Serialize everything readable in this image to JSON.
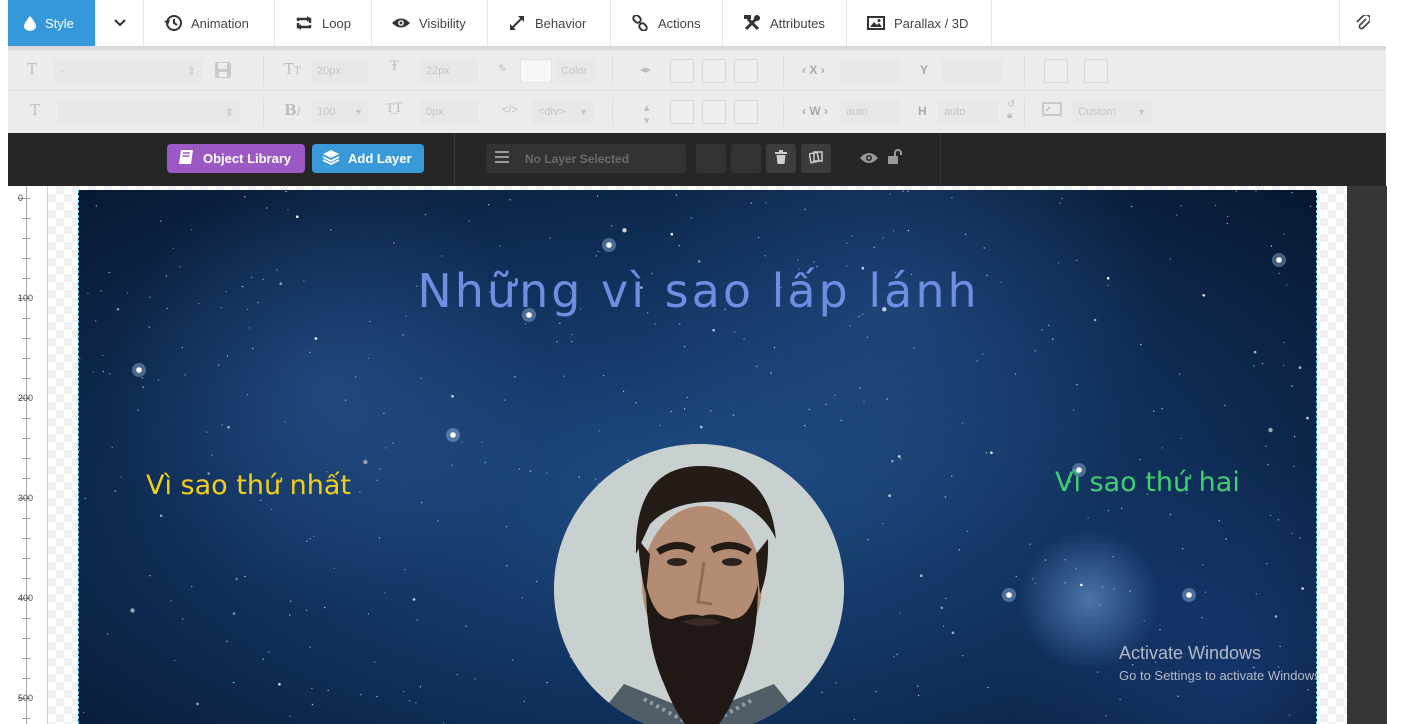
{
  "tabs": [
    {
      "label": "Style",
      "icon": "droplet-icon",
      "active": true
    },
    {
      "label": "Animation",
      "icon": "history-icon"
    },
    {
      "label": "Loop",
      "icon": "loop-icon"
    },
    {
      "label": "Visibility",
      "icon": "eye-icon"
    },
    {
      "label": "Behavior",
      "icon": "expand-arrows-icon"
    },
    {
      "label": "Actions",
      "icon": "link-icon"
    },
    {
      "label": "Attributes",
      "icon": "tools-icon"
    },
    {
      "label": "Parallax / 3D",
      "icon": "image-icon"
    }
  ],
  "style_panel": {
    "font_family_value": "-",
    "font_size": "20px",
    "line_height": "22px",
    "color_label": "Color",
    "font_weight": "100",
    "letter_spacing": "0px",
    "tag": "<div>",
    "x_label": "X",
    "y_label": "Y",
    "w_label": "W",
    "w_value": "auto",
    "h_label": "H",
    "h_value": "auto",
    "size_preset": "Custom"
  },
  "layer_toolbar": {
    "object_library_label": "Object Library",
    "add_layer_label": "Add Layer",
    "layer_select_value": "No Layer Selected"
  },
  "ruler": {
    "marks": [
      "0",
      "100",
      "200",
      "300",
      "400",
      "500"
    ]
  },
  "slide": {
    "title": "Những vì sao lấp lánh",
    "left_caption": "Vì sao thứ nhất",
    "right_caption": "Vì sao thứ hai"
  },
  "watermark": {
    "line1": "Activate Windows",
    "line2": "Go to Settings to activate Windows."
  },
  "colors": {
    "accent": "#3498db",
    "object_library": "#9c59c4",
    "add_layer": "#3a9ad9",
    "title": "#6e8ee2",
    "left_caption": "#f4cf1a",
    "right_caption": "#3ed174"
  }
}
